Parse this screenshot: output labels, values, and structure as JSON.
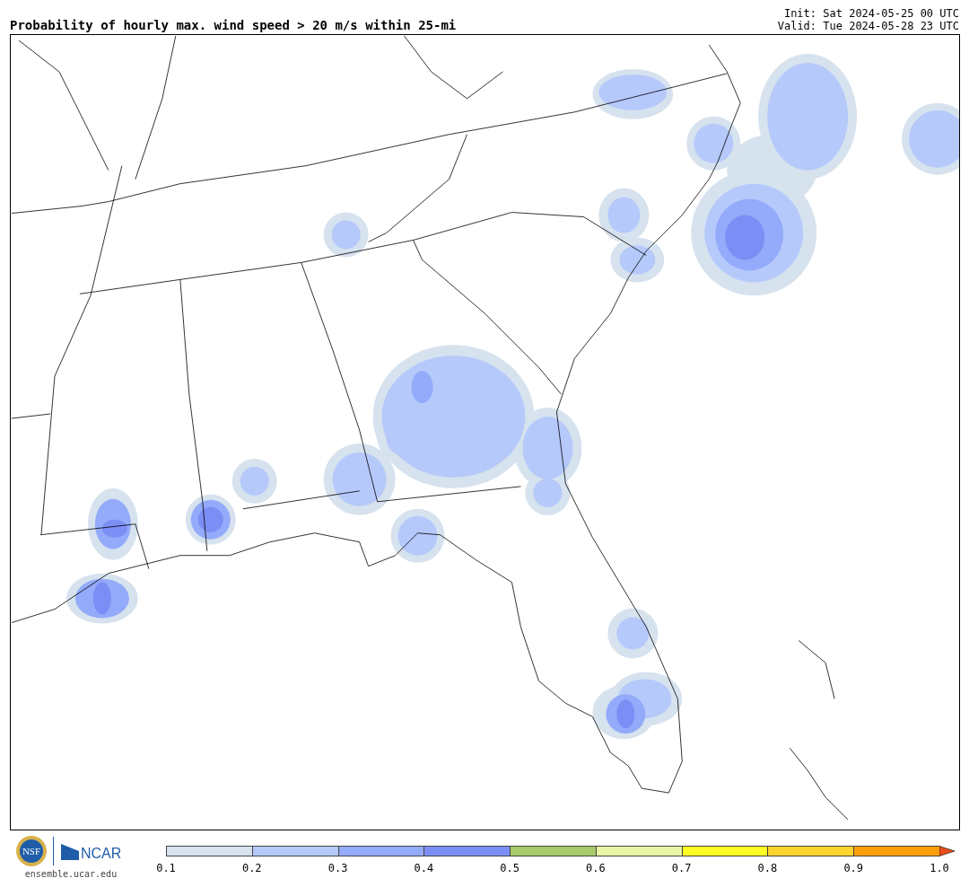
{
  "title": "Probability of hourly max. wind speed > 20 m/s within 25-mi",
  "init": "Init: Sat 2024-05-25 00 UTC",
  "valid": "Valid: Tue 2024-05-28 23 UTC",
  "logos": {
    "nsf": "NSF",
    "ncar": "NCAR",
    "url": "ensemble.ucar.edu"
  },
  "colorbar": {
    "segments": [
      {
        "color": "#d6e2ee"
      },
      {
        "color": "#b5c9fb"
      },
      {
        "color": "#94aafa"
      },
      {
        "color": "#7b8ef6"
      },
      {
        "color": "#a6cb6a"
      },
      {
        "color": "#e9f5a4"
      },
      {
        "color": "#fdfd23"
      },
      {
        "color": "#fdd32e"
      },
      {
        "color": "#fb9e0c"
      },
      {
        "kind": "extend-arrow",
        "color": "#e8501c"
      }
    ],
    "ticks": [
      "0.1",
      "0.2",
      "0.3",
      "0.4",
      "0.5",
      "0.6",
      "0.7",
      "0.8",
      "0.9",
      "1.0"
    ]
  }
}
